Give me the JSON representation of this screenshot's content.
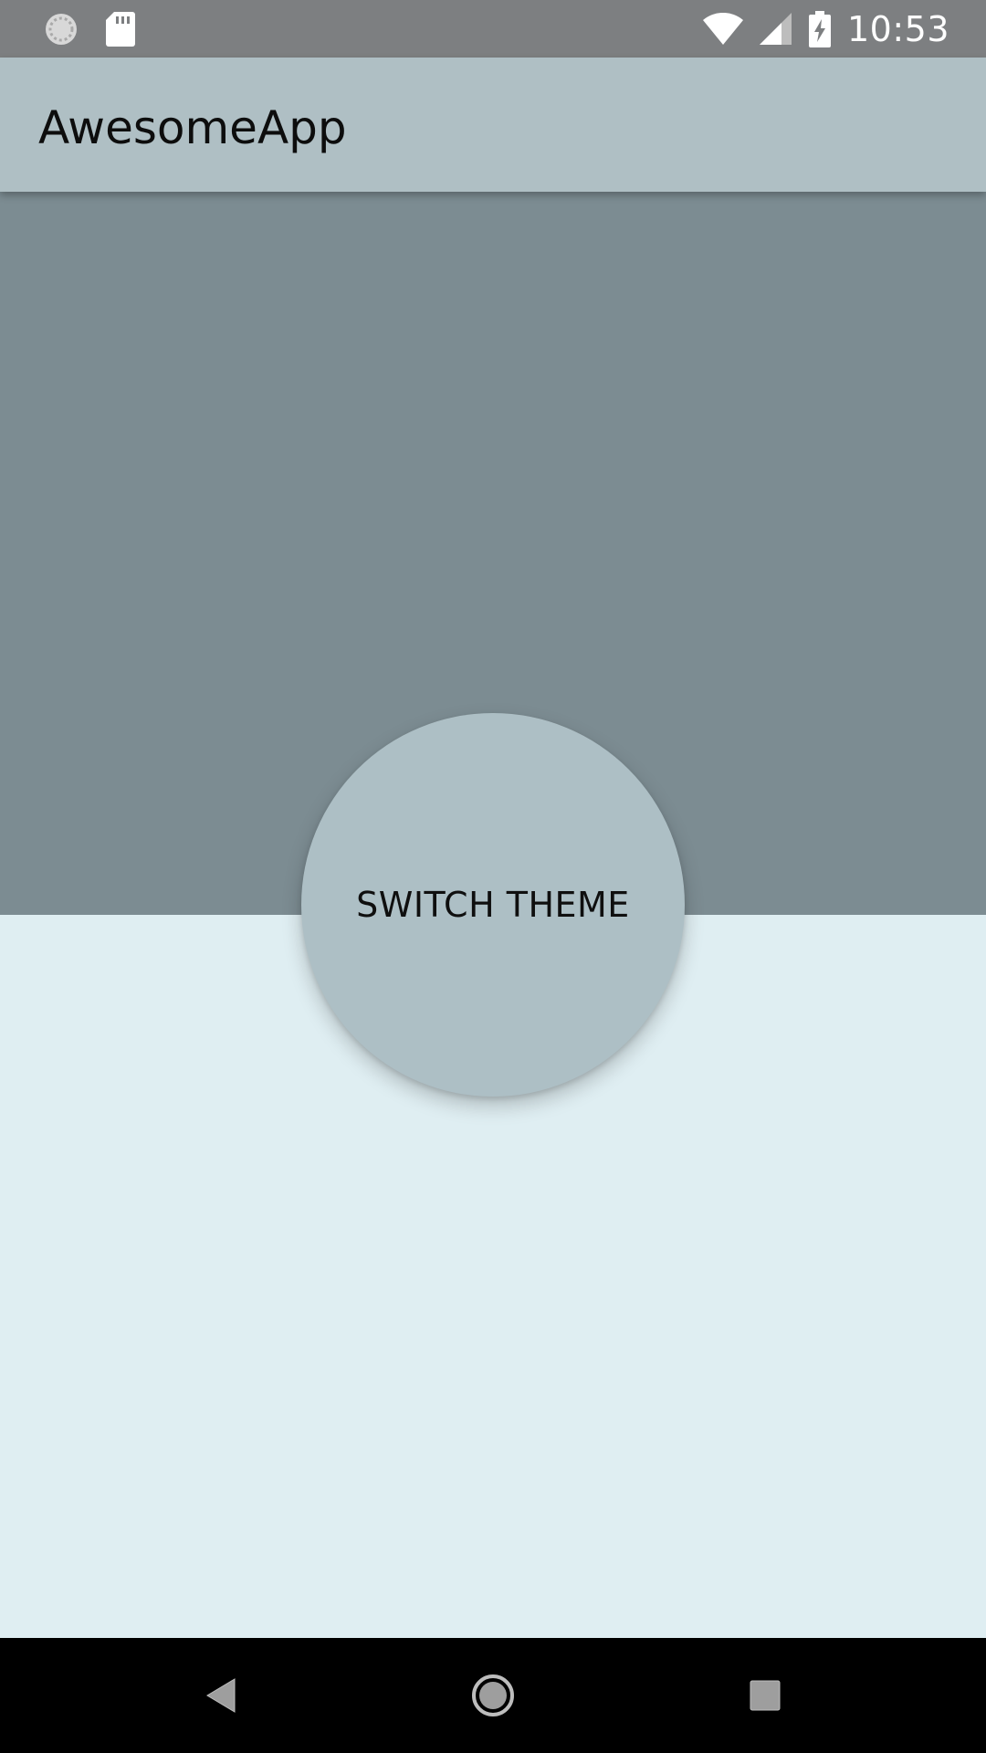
{
  "status_bar": {
    "time": "10:53",
    "left_icons": [
      "loading-circle-icon",
      "sd-card-icon"
    ],
    "right_icons": [
      "wifi-icon",
      "cell-signal-icon",
      "battery-charging-icon"
    ]
  },
  "app_bar": {
    "title": "AwesomeApp"
  },
  "main": {
    "switch_button_label": "SWITCH THEME"
  },
  "nav_bar": {
    "buttons": [
      "back-icon",
      "home-icon",
      "recents-icon"
    ]
  },
  "colors": {
    "status_bar": "#7d7f81",
    "app_bar": "#afbfc4",
    "top_section": "#7c8c92",
    "bottom_section": "#dfeef2",
    "button": "#adbfc5",
    "nav_bar": "#000000"
  }
}
